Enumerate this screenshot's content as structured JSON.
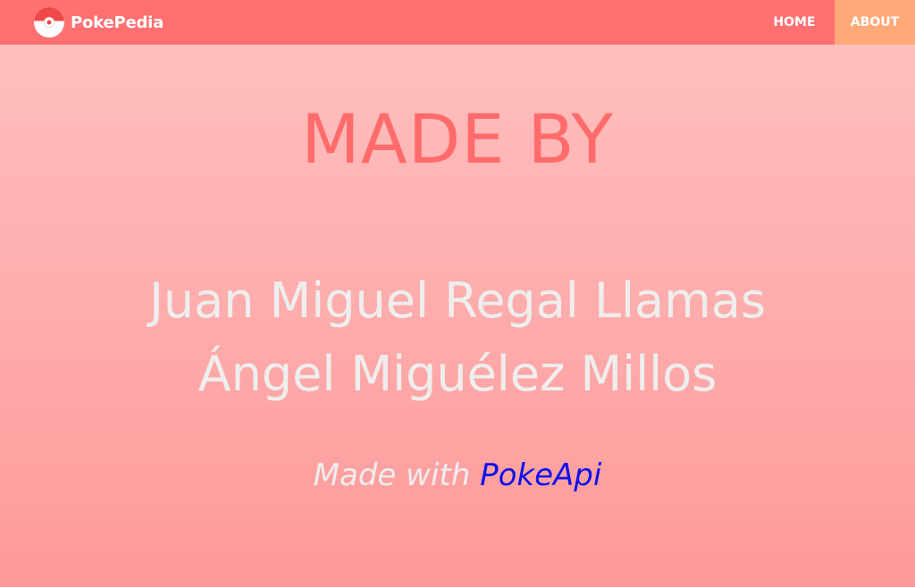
{
  "navbar": {
    "brand": "PokePedia",
    "links": [
      {
        "label": "HOME"
      },
      {
        "label": "ABOUT"
      }
    ]
  },
  "main": {
    "heading": "MADE BY",
    "authors": [
      "Juan Miguel Regal Llamas",
      "Ángel Miguélez Millos"
    ],
    "note_prefix": "Made with",
    "note_link": "PokeApi"
  },
  "colors": {
    "navbar": "#ff7070",
    "active_tab": "#ffa978",
    "heading": "#ff6b6b",
    "link": "#1010ee"
  }
}
